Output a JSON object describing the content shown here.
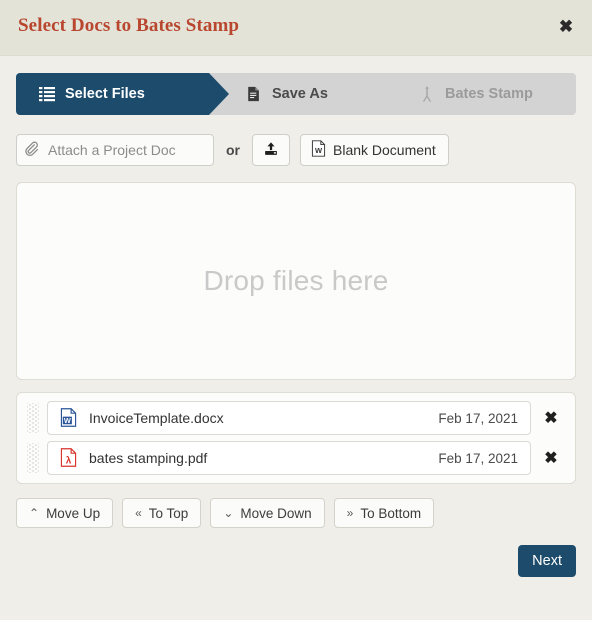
{
  "dialog": {
    "title": "Select Docs to Bates Stamp",
    "close_label": "✖"
  },
  "steps": [
    {
      "label": "Select Files",
      "icon": "list-icon",
      "state": "active"
    },
    {
      "label": "Save As",
      "icon": "document-icon",
      "state": "next"
    },
    {
      "label": "Bates Stamp",
      "icon": "stamp-icon",
      "state": "inactive"
    }
  ],
  "attach": {
    "placeholder": "Attach a Project Doc",
    "value": "",
    "or_label": "or",
    "upload_label": "",
    "blank_document_label": "Blank Document"
  },
  "dropzone": {
    "text": "Drop files here"
  },
  "files": [
    {
      "name": "InvoiceTemplate.docx",
      "date": "Feb 17, 2021",
      "type": "docx",
      "remove_label": "✖"
    },
    {
      "name": "bates stamping.pdf",
      "date": "Feb 17, 2021",
      "type": "pdf",
      "remove_label": "✖"
    }
  ],
  "move_buttons": [
    {
      "label": "Move Up",
      "chev": "⌃"
    },
    {
      "label": "To Top",
      "chev": "«"
    },
    {
      "label": "Move Down",
      "chev": "⌄"
    },
    {
      "label": "To Bottom",
      "chev": "»"
    }
  ],
  "footer": {
    "next_label": "Next"
  },
  "colors": {
    "accent": "#1d4b6b",
    "title": "#b9462f",
    "header_bg": "#e3e3d7",
    "body_bg": "#efeee8",
    "step_inactive_bg": "#d3d3d3",
    "word_blue": "#2a5699",
    "pdf_red": "#d9352c"
  }
}
